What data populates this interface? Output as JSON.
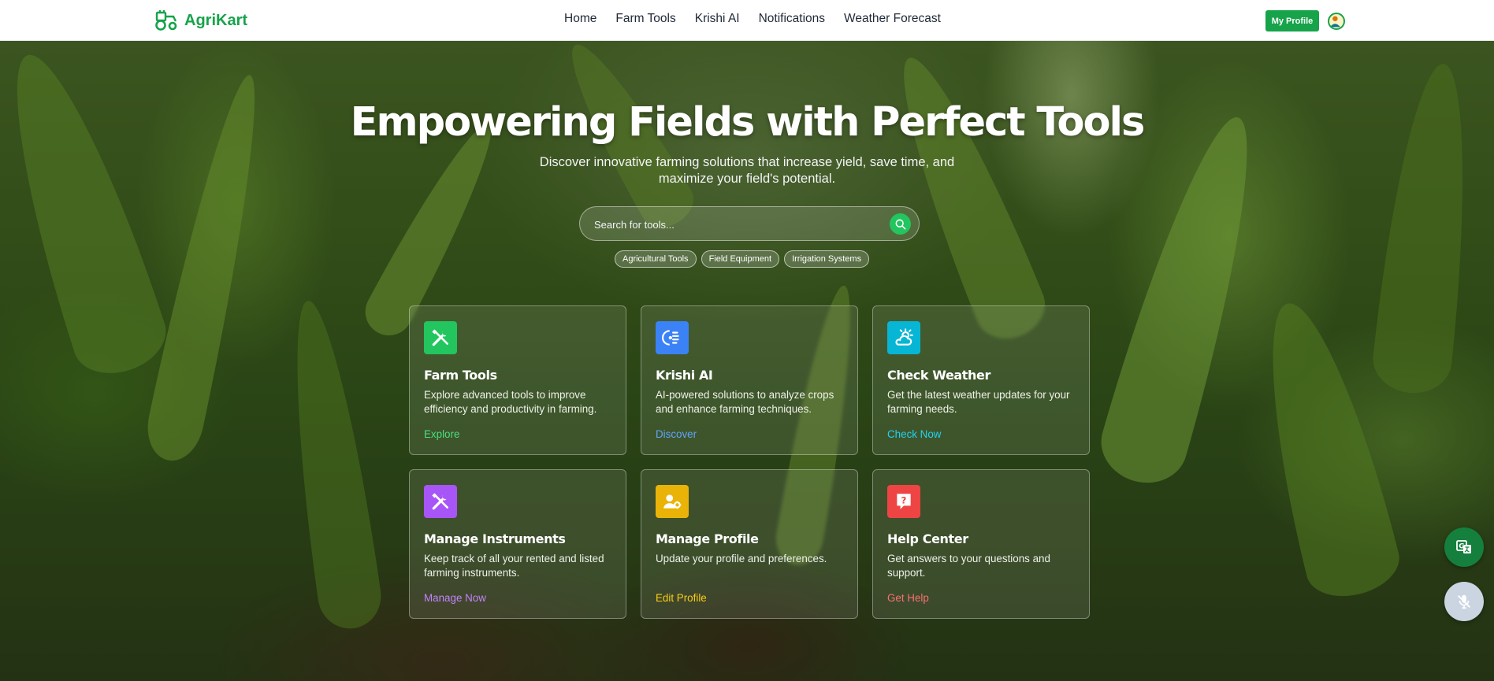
{
  "brand": {
    "name": "AgriKart",
    "icon": "tractor-icon",
    "color": "#16a34a"
  },
  "nav": {
    "links": [
      "Home",
      "Farm Tools",
      "Krishi AI",
      "Notifications",
      "Weather Forecast"
    ],
    "profile_button": "My Profile"
  },
  "hero": {
    "title": "Empowering Fields with Perfect Tools",
    "subtitle": "Discover innovative farming solutions that increase yield, save time, and maximize your field's potential."
  },
  "search": {
    "placeholder": "Search for tools...",
    "chips": [
      "Agricultural Tools",
      "Field Equipment",
      "Irrigation Systems"
    ]
  },
  "cards": [
    {
      "title": "Farm Tools",
      "description": "Explore advanced tools to improve efficiency and productivity in farming.",
      "link": "Explore",
      "icon": "tools-icon",
      "color": "#22c55e",
      "link_color": "#4ade80"
    },
    {
      "title": "Krishi AI",
      "description": "AI-powered solutions to analyze crops and enhance farming techniques.",
      "link": "Discover",
      "icon": "ai-brain-icon",
      "color": "#3b82f6",
      "link_color": "#60a5fa"
    },
    {
      "title": "Check Weather",
      "description": "Get the latest weather updates for your farming needs.",
      "link": "Check Now",
      "icon": "cloud-sun-icon",
      "color": "#06b6d4",
      "link_color": "#22d3ee"
    },
    {
      "title": "Manage Instruments",
      "description": "Keep track of all your rented and listed farming instruments.",
      "link": "Manage Now",
      "icon": "wrench-screwdriver-icon",
      "color": "#a855f7",
      "link_color": "#c084fc"
    },
    {
      "title": "Manage Profile",
      "description": "Update your profile and preferences.",
      "link": "Edit Profile",
      "icon": "user-gear-icon",
      "color": "#eab308",
      "link_color": "#facc15"
    },
    {
      "title": "Help Center",
      "description": "Get answers to your questions and support.",
      "link": "Get Help",
      "icon": "help-question-icon",
      "color": "#ef4444",
      "link_color": "#f87171"
    }
  ],
  "floating": {
    "translate_icon": "translate-icon",
    "mic_icon": "mic-off-icon"
  }
}
